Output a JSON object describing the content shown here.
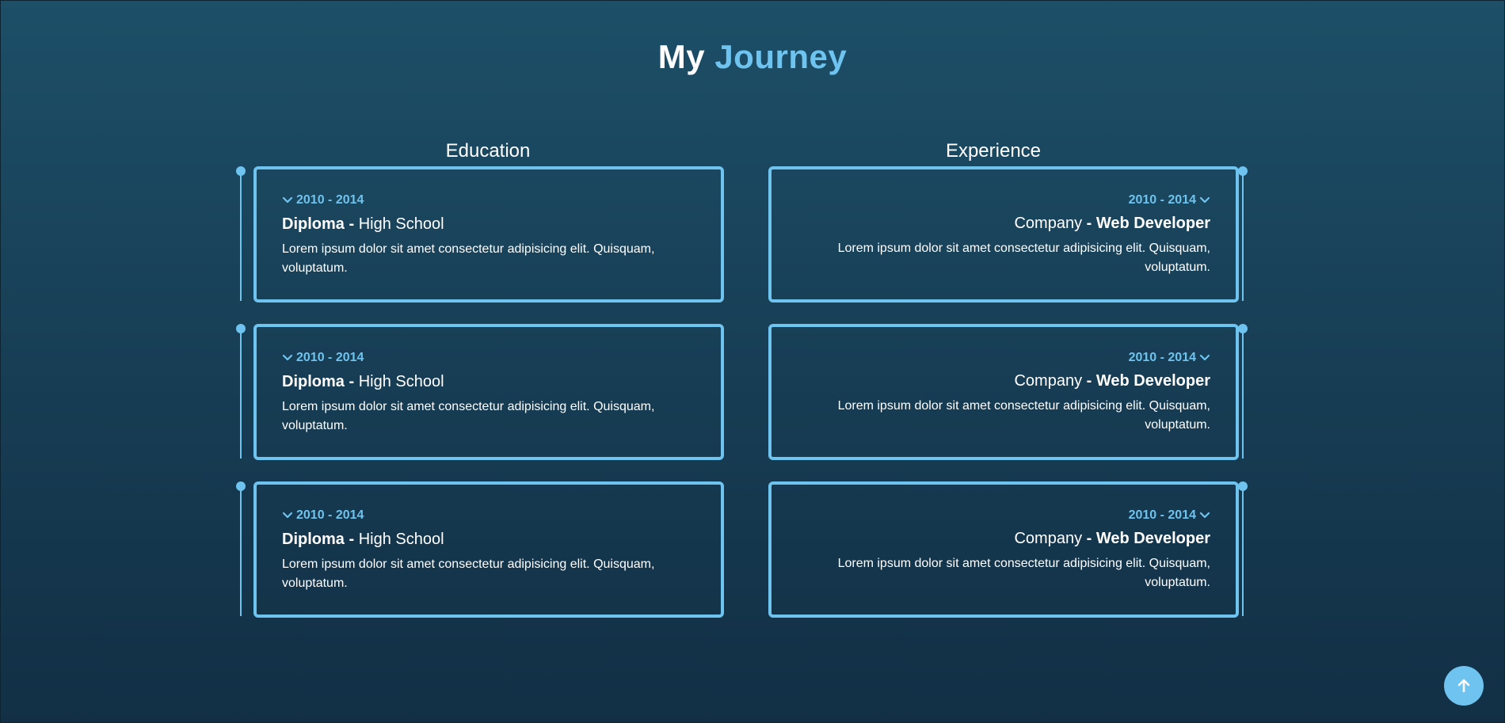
{
  "heading": {
    "word1": "My",
    "word2": "Journey"
  },
  "education": {
    "title": "Education",
    "items": [
      {
        "date": "2010 - 2014",
        "degree": "Diploma -",
        "school": "High School",
        "description": "Lorem ipsum dolor sit amet consectetur adipisicing elit. Quisquam, voluptatum."
      },
      {
        "date": "2010 - 2014",
        "degree": "Diploma -",
        "school": "High School",
        "description": "Lorem ipsum dolor sit amet consectetur adipisicing elit. Quisquam, voluptatum."
      },
      {
        "date": "2010 - 2014",
        "degree": "Diploma -",
        "school": "High School",
        "description": "Lorem ipsum dolor sit amet consectetur adipisicing elit. Quisquam, voluptatum."
      }
    ]
  },
  "experience": {
    "title": "Experience",
    "items": [
      {
        "date": "2010 - 2014",
        "company": "Company",
        "role": "- Web Developer",
        "description": "Lorem ipsum dolor sit amet consectetur adipisicing elit. Quisquam, voluptatum."
      },
      {
        "date": "2010 - 2014",
        "company": "Company",
        "role": "- Web Developer",
        "description": "Lorem ipsum dolor sit amet consectetur adipisicing elit. Quisquam, voluptatum."
      },
      {
        "date": "2010 - 2014",
        "company": "Company",
        "role": "- Web Developer",
        "description": "Lorem ipsum dolor sit amet consectetur adipisicing elit. Quisquam, voluptatum."
      }
    ]
  },
  "icons": {
    "date_toggle": "chevron-down-icon",
    "scroll_top": "arrow-up-icon"
  },
  "colors": {
    "accent": "#6ec3ef",
    "background_top": "#1d4f68",
    "background_bottom": "#122f45",
    "text": "#ffffff"
  }
}
